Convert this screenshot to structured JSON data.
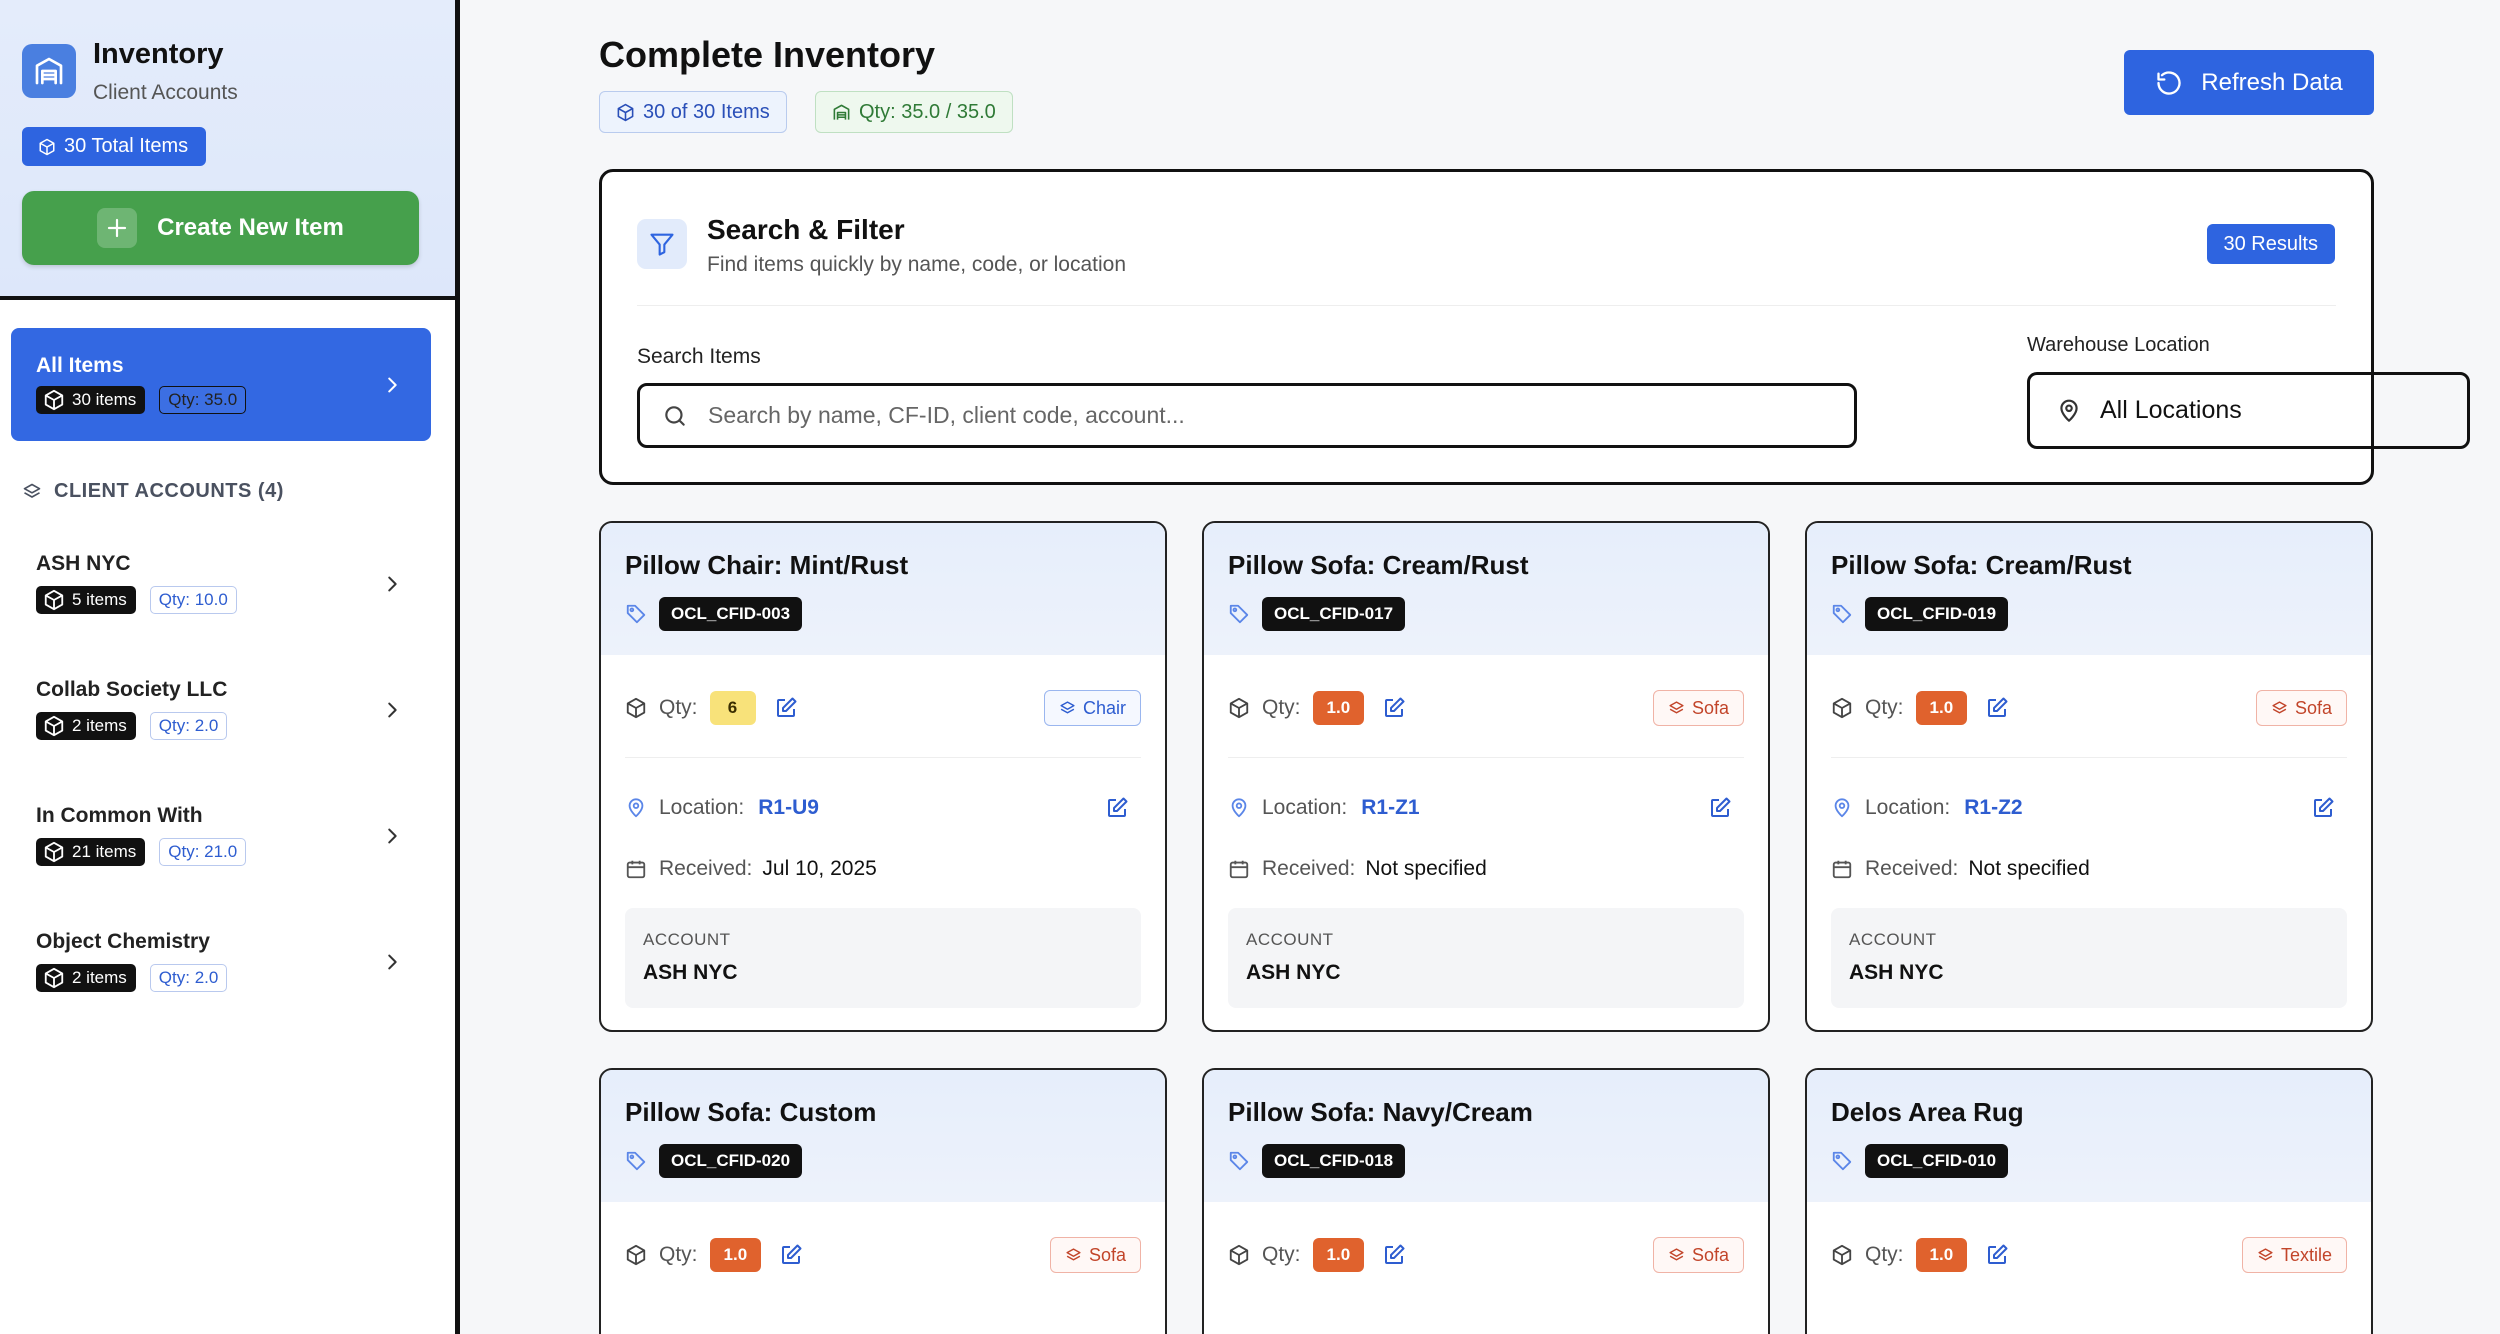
{
  "sidebar": {
    "app_title": "Inventory",
    "app_subtitle": "Client Accounts",
    "total_badge": "30 Total Items",
    "create_button": "Create New Item",
    "all_items": {
      "label": "All Items",
      "count": "30 items",
      "qty": "Qty: 35.0"
    },
    "section_title": "CLIENT ACCOUNTS (4)",
    "clients": [
      {
        "name": "ASH NYC",
        "count": "5 items",
        "qty": "Qty: 10.0"
      },
      {
        "name": "Collab Society LLC",
        "count": "2 items",
        "qty": "Qty: 2.0"
      },
      {
        "name": "In Common With",
        "count": "21 items",
        "qty": "Qty: 21.0"
      },
      {
        "name": "Object Chemistry",
        "count": "2 items",
        "qty": "Qty: 2.0"
      }
    ]
  },
  "header": {
    "title": "Complete Inventory",
    "items_pill": "30 of 30 Items",
    "qty_pill": "Qty: 35.0 / 35.0",
    "refresh_button": "Refresh Data"
  },
  "filter": {
    "title": "Search & Filter",
    "subtitle": "Find items quickly by name, code, or location",
    "results_badge": "30 Results",
    "search_label": "Search Items",
    "search_placeholder": "Search by name, CF-ID, client code, account...",
    "location_label": "Warehouse Location",
    "location_value": "All Locations"
  },
  "labels": {
    "qty": "Qty:",
    "location": "Location:",
    "received": "Received:",
    "account": "ACCOUNT"
  },
  "items": [
    {
      "name": "Pillow Chair: Mint/Rust",
      "code": "OCL_CFID-003",
      "qty": "6",
      "category": "Chair",
      "location": "R1-U9",
      "received": "Jul 10, 2025",
      "account": "ASH NYC"
    },
    {
      "name": "Pillow Sofa: Cream/Rust",
      "code": "OCL_CFID-017",
      "qty": "1.0",
      "category": "Sofa",
      "location": "R1-Z1",
      "received": "Not specified",
      "account": "ASH NYC"
    },
    {
      "name": "Pillow Sofa: Cream/Rust",
      "code": "OCL_CFID-019",
      "qty": "1.0",
      "category": "Sofa",
      "location": "R1-Z2",
      "received": "Not specified",
      "account": "ASH NYC"
    },
    {
      "name": "Pillow Sofa: Custom",
      "code": "OCL_CFID-020",
      "qty": "1.0",
      "category": "Sofa"
    },
    {
      "name": "Pillow Sofa: Navy/Cream",
      "code": "OCL_CFID-018",
      "qty": "1.0",
      "category": "Sofa"
    },
    {
      "name": "Delos Area Rug",
      "code": "OCL_CFID-010",
      "qty": "1.0",
      "category": "Textile"
    }
  ],
  "colors": {
    "primary_blue": "#2e64e0",
    "create_green": "#46a04c",
    "qty_orange": "#e0622d",
    "qty_yellow": "#f8e27a",
    "location_blue": "#2e5dd0"
  }
}
